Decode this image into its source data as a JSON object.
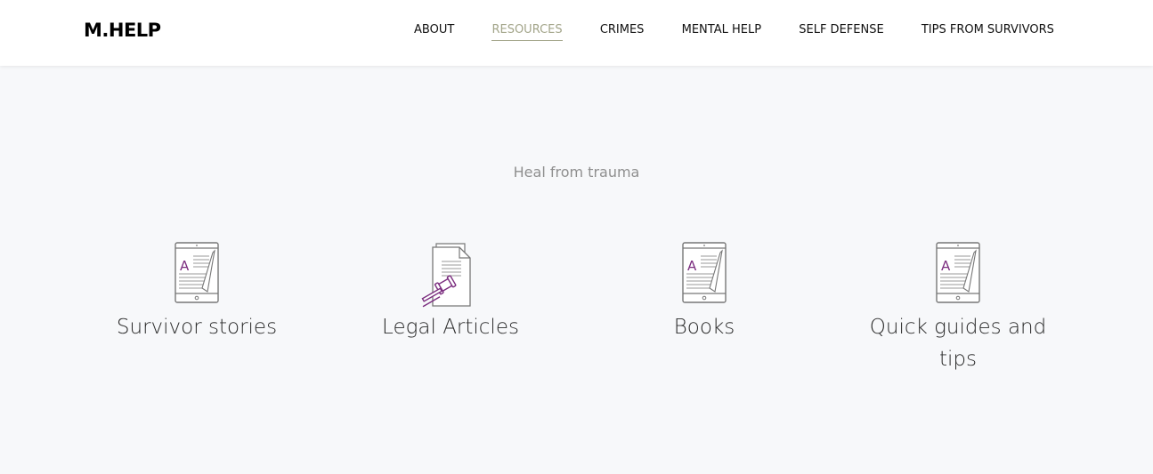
{
  "header": {
    "logo": "M.HELP",
    "nav": [
      {
        "label": "ABOUT",
        "active": false
      },
      {
        "label": "RESOURCES",
        "active": true
      },
      {
        "label": "CRIMES",
        "active": false
      },
      {
        "label": "MENTAL HELP",
        "active": false
      },
      {
        "label": "SELF DEFENSE",
        "active": false
      },
      {
        "label": "TIPS FROM SURVIVORS",
        "active": false
      }
    ]
  },
  "main": {
    "subtitle": "Heal from trauma",
    "cards": [
      {
        "label": "Survivor stories",
        "icon": "tablet-document-icon"
      },
      {
        "label": "Legal Articles",
        "icon": "gavel-document-icon"
      },
      {
        "label": "Books",
        "icon": "tablet-document-icon"
      },
      {
        "label": "Quick guides and tips",
        "icon": "tablet-document-icon"
      }
    ]
  },
  "colors": {
    "accent": "#a3a58a",
    "icon_purple": "#7b2d7f",
    "icon_gray": "#777777",
    "background": "#f7f8fa"
  }
}
